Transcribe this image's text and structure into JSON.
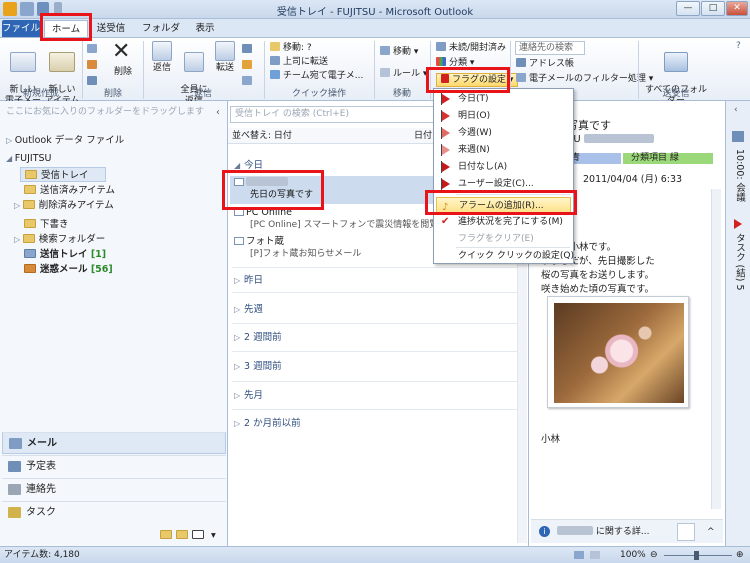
{
  "window": {
    "title": "受信トレイ - FUJITSU - Microsoft Outlook",
    "controls": {
      "minimize": "—",
      "maximize": "□",
      "close": "✕"
    }
  },
  "tabs": [
    "ファイル",
    "ホーム",
    "送受信",
    "フォルダー",
    "表示"
  ],
  "ribbon": {
    "new_group": {
      "label": "新規作成",
      "new_email": "新しい\n電子メール",
      "new_items": "新しい\nアイテム"
    },
    "delete_group": {
      "label": "削除",
      "delete": "削除"
    },
    "respond_group": {
      "label": "返信",
      "reply": "返信",
      "reply_all": "全員に\n返信",
      "forward": "転送"
    },
    "quick_steps_group": {
      "label": "クイック操作",
      "move_to": "移動: ?",
      "to_manager": "上司に転送",
      "team_email": "チーム宛て電子メ..."
    },
    "move_group": {
      "label": "移動",
      "move": "移動",
      "rules": "ルール"
    },
    "tags_group": {
      "unread_read": "未読/開封済み",
      "categorize": "分類",
      "followup": "フラグの設定"
    },
    "find_group": {
      "search_contacts": "連絡先の検索",
      "address_book": "アドレス帳",
      "filter_email": "電子メールのフィルター処理"
    },
    "send_receive_group": {
      "label": "送受信",
      "send_receive_all": "すべてのフォルダー\nを送受信"
    }
  },
  "nav": {
    "favorites_hint": "ここにお気に入りのフォルダーをドラッグします",
    "outlook_data_file": "Outlook データ ファイル",
    "account": "FUJITSU",
    "folders": [
      {
        "name": "受信トレイ",
        "count": ""
      },
      {
        "name": "送信済みアイテム",
        "count": ""
      },
      {
        "name": "削除済みアイテム",
        "count": ""
      },
      {
        "name": "下書き",
        "count": ""
      },
      {
        "name": "検索フォルダー",
        "count": ""
      },
      {
        "name": "送信トレイ",
        "count": "[1]"
      },
      {
        "name": "迷惑メール",
        "count": "[56]"
      }
    ],
    "modules": [
      "メール",
      "予定表",
      "連絡先",
      "タスク"
    ]
  },
  "list": {
    "search_placeholder": "受信トレイ の検索 (Ctrl+E)",
    "sort_label": "並べ替え: 日付",
    "sort_col": "日付",
    "groups": {
      "today": "今日",
      "yesterday": "昨日",
      "last_week": "先週",
      "two_weeks": "2 週間前",
      "three_weeks": "3 週間前",
      "last_month": "先月",
      "older": "2 か月前以前"
    },
    "messages": [
      {
        "from": "",
        "subject": "先日の写真です"
      },
      {
        "from": "PC Online",
        "subject": "[PC Online] スマートフォンで震災情報を閲覧／春の"
      },
      {
        "from": "フォト蔵",
        "subject": "[P]フォト蔵お知らせメール"
      }
    ]
  },
  "reading": {
    "title": "写真です",
    "sender": "SU",
    "category_blue": "青",
    "category_green": "分類項目 緑",
    "date": "2011/04/04 (月) 6:33",
    "body_lines": [
      "ちは。小林です。",
      "りましたが、先日撮影した",
      "桜の写真をお送りします。",
      "咲き始めた頃の写真です。"
    ],
    "signature": "小林",
    "people_pane": "に関する詳..."
  },
  "todo": {
    "calendar": "10:00: 会議",
    "tasks": "タスク (結) 5"
  },
  "status": {
    "item_count": "アイテム数: 4,180",
    "zoom": "100%"
  },
  "flag_menu": {
    "items": [
      {
        "label": "今日(T)",
        "flag": "#d21f1f"
      },
      {
        "label": "明日(O)",
        "flag": "#d9332f"
      },
      {
        "label": "今週(W)",
        "flag": "#e26a66"
      },
      {
        "label": "来週(N)",
        "flag": "#e88d89"
      },
      {
        "label": "日付なし(A)",
        "flag": "#c61a1a"
      },
      {
        "label": "ユーザー設定(C)...",
        "flag": "#c61a1a"
      },
      {
        "label": "アラームの追加(R)..."
      },
      {
        "label": "進捗状況を完了にする(M)"
      },
      {
        "label": "フラグをクリア(E)"
      },
      {
        "label": "クイック クリックの設定(Q)..."
      }
    ]
  }
}
